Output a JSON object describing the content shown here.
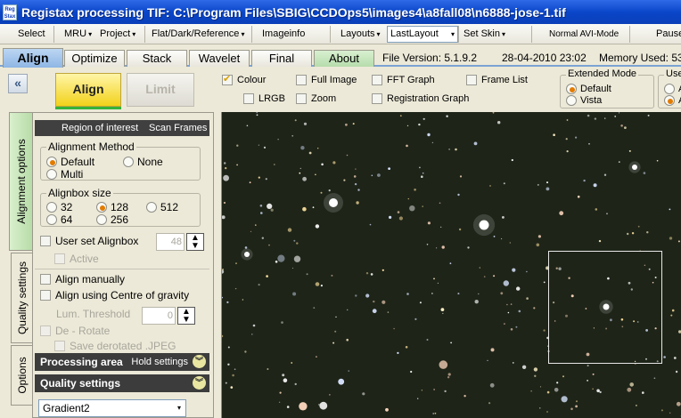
{
  "window": {
    "title": "Registax processing TIF: C:\\Program Files\\SBIG\\CCDOps5\\images4\\a8fall08\\n6888-jose-1.tif",
    "icon_label": "Reg Stax"
  },
  "menubar": {
    "select": "Select",
    "mru": "MRU",
    "project": "Project",
    "flat_dark_ref": "Flat/Dark/Reference",
    "imageinfo": "Imageinfo",
    "layouts": "Layouts",
    "layout_value": "LastLayout",
    "set_skin": "Set Skin",
    "normal_avi_mode": "Normal AVI-Mode",
    "pause": "Pause"
  },
  "tabs": {
    "align": "Align",
    "optimize": "Optimize",
    "stack": "Stack",
    "wavelet": "Wavelet",
    "final": "Final",
    "about": "About",
    "file_version": "File Version: 5.1.9.2",
    "date": "28-04-2010 23:02",
    "memory": "Memory Used: 53"
  },
  "toolbar": {
    "collapse": "«",
    "align_button": "Align",
    "limit_button": "Limit",
    "colour": "Colour",
    "lrgb": "LRGB",
    "full_image": "Full Image",
    "zoom": "Zoom",
    "fft_graph": "FFT Graph",
    "registration_graph": "Registration Graph",
    "frame_list": "Frame List",
    "extended_mode": {
      "legend": "Extended Mode",
      "default": "Default",
      "vista": "Vista"
    },
    "use_legend": "Use",
    "use_option": "A",
    "use_option2": "A"
  },
  "sidetabs": {
    "alignment_options": "Alignment options",
    "quality_settings": "Quality settings",
    "options": "Options"
  },
  "panel": {
    "region_of_interest": "Region of interest",
    "scan_frames": "Scan Frames",
    "alignment_method": {
      "legend": "Alignment Method",
      "default": "Default",
      "none": "None",
      "multi": "Multi"
    },
    "alignbox_size": {
      "legend": "Alignbox size",
      "s32": "32",
      "s128": "128",
      "s512": "512",
      "s64": "64",
      "s256": "256"
    },
    "user_set_alignbox": "User set Alignbox",
    "user_alignbox_value": "48",
    "active": "Active",
    "align_manually": "Align manually",
    "align_centre_gravity": "Align using Centre of gravity",
    "lum_threshold": "Lum. Threshold",
    "lum_threshold_value": "0",
    "de_rotate": "De - Rotate",
    "save_derotated": "Save derotated .JPEG",
    "processing_area": "Processing area",
    "hold_settings": "Hold settings",
    "quality_settings": "Quality settings",
    "quality_method": "Gradient2"
  },
  "colors": {
    "title_bar": "#0a46c9",
    "active_tab": "#8eb6e4",
    "align_button": "#f2d21a",
    "radio_dot": "#e27b00",
    "panel_header": "#3c3c3c",
    "image_background": "#1e2418"
  }
}
